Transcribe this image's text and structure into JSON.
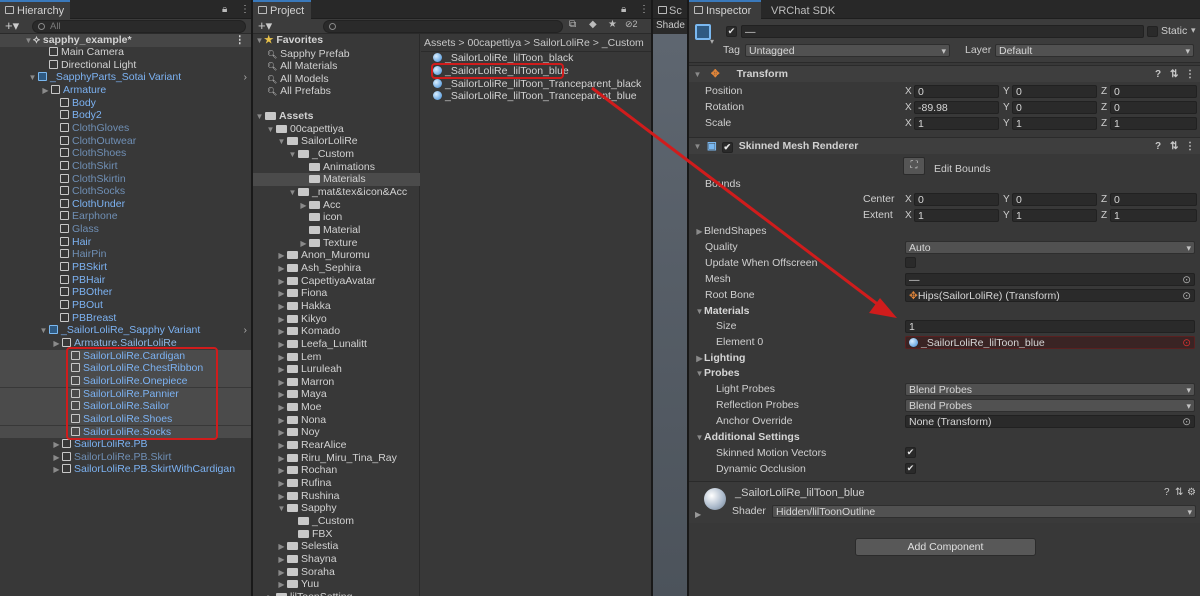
{
  "hierarchy": {
    "tab": "Hierarchy",
    "search_placeholder": "All",
    "scene": "sapphy_example*",
    "items": [
      {
        "label": "Main Camera",
        "cls": ""
      },
      {
        "label": "Directional Light",
        "cls": ""
      },
      {
        "label": "_SapphyParts_Sotai Variant",
        "cls": "blue"
      },
      {
        "label": "Armature",
        "cls": "blue"
      },
      {
        "label": "Body",
        "cls": "blue"
      },
      {
        "label": "Body2",
        "cls": "blue"
      },
      {
        "label": "ClothGloves",
        "cls": "dim"
      },
      {
        "label": "ClothOutwear",
        "cls": "dim"
      },
      {
        "label": "ClothShoes",
        "cls": "dim"
      },
      {
        "label": "ClothSkirt",
        "cls": "dim"
      },
      {
        "label": "ClothSkirtin",
        "cls": "dim"
      },
      {
        "label": "ClothSocks",
        "cls": "dim"
      },
      {
        "label": "ClothUnder",
        "cls": "blue"
      },
      {
        "label": "Earphone",
        "cls": "dim"
      },
      {
        "label": "Glass",
        "cls": "dim"
      },
      {
        "label": "Hair",
        "cls": "blue"
      },
      {
        "label": "HairPin",
        "cls": "dim"
      },
      {
        "label": "PBSkirt",
        "cls": "blue"
      },
      {
        "label": "PBHair",
        "cls": "blue"
      },
      {
        "label": "PBOther",
        "cls": "blue"
      },
      {
        "label": "PBOut",
        "cls": "blue"
      },
      {
        "label": "PBBreast",
        "cls": "blue"
      },
      {
        "label": "_SailorLoliRe_Sapphy Variant",
        "cls": "blue"
      },
      {
        "label": "Armature.SailorLoliRe",
        "cls": "blue"
      },
      {
        "label": "SailorLoliRe.Cardigan",
        "cls": "blue"
      },
      {
        "label": "SailorLoliRe.ChestRibbon",
        "cls": "blue"
      },
      {
        "label": "SailorLoliRe.Onepiece",
        "cls": "blue"
      },
      {
        "label": "SailorLoliRe.Pannier",
        "cls": "blue"
      },
      {
        "label": "SailorLoliRe.Sailor",
        "cls": "blue"
      },
      {
        "label": "SailorLoliRe.Shoes",
        "cls": "blue"
      },
      {
        "label": "SailorLoliRe.Socks",
        "cls": "blue"
      },
      {
        "label": "SailorLoliRe.PB",
        "cls": "blue"
      },
      {
        "label": "SailorLoliRe.PB.Skirt",
        "cls": "dim"
      },
      {
        "label": "SailorLoliRe.PB.SkirtWithCardigan",
        "cls": "blue"
      }
    ]
  },
  "project": {
    "tab": "Project",
    "favorites_label": "Favorites",
    "favorites": [
      "Sapphy Prefab",
      "All Materials",
      "All Models",
      "All Prefabs"
    ],
    "assets_label": "Assets",
    "tree": [
      "00capettiya",
      "SailorLoliRe",
      "_Custom",
      "Animations",
      "Materials",
      "_mat&tex&icon&Acc",
      "Acc",
      "icon",
      "Material",
      "Texture",
      "Anon_Muromu",
      "Ash_Sephira",
      "CapettiyaAvatar",
      "Fiona",
      "Hakka",
      "Kikyo",
      "Komado",
      "Leefa_Lunalitt",
      "Lem",
      "Luruleah",
      "Marron",
      "Maya",
      "Moe",
      "Nona",
      "Noy",
      "RearAlice",
      "Riru_Miru_Tina_Ray",
      "Rochan",
      "Rufina",
      "Rushina",
      "Sapphy",
      "_Custom",
      "FBX",
      "Selestia",
      "Shayna",
      "Soraha",
      "Yuu",
      "lilToonSetting"
    ],
    "breadcrumb": [
      "Assets",
      "00capettiya",
      "SailorLoliRe",
      "_Custom"
    ],
    "files": [
      "_SailorLoliRe_lilToon_black",
      "_SailorLoliRe_lilToon_blue",
      "_SailorLoliRe_lilToon_Tranceparent_black",
      "_SailorLoliRe_lilToon_Tranceparent_blue"
    ],
    "hidden_count": "2"
  },
  "scene_tab": {
    "tab": "Sc",
    "shade": "Shade"
  },
  "inspector": {
    "tab": "Inspector",
    "tab2": "VRChat SDK",
    "object_name": "—",
    "static_label": "Static",
    "tag_label": "Tag",
    "tag_value": "Untagged",
    "layer_label": "Layer",
    "layer_value": "Default",
    "transform": {
      "title": "Transform",
      "position_label": "Position",
      "position": [
        "0",
        "0",
        "0"
      ],
      "rotation_label": "Rotation",
      "rotation": [
        "-89.98",
        "0",
        "0"
      ],
      "scale_label": "Scale",
      "scale": [
        "1",
        "1",
        "1"
      ]
    },
    "smr": {
      "title": "Skinned Mesh Renderer",
      "edit_bounds": "Edit Bounds",
      "bounds_label": "Bounds",
      "center_label": "Center",
      "center": [
        "0",
        "0",
        "0"
      ],
      "extent_label": "Extent",
      "extent": [
        "1",
        "1",
        "1"
      ],
      "blendshapes": "BlendShapes",
      "quality_label": "Quality",
      "quality": "Auto",
      "update_offscreen_label": "Update When Offscreen",
      "mesh_label": "Mesh",
      "mesh": "—",
      "root_bone_label": "Root Bone",
      "root_bone": "Hips(SailorLoliRe) (Transform)",
      "materials_label": "Materials",
      "size_label": "Size",
      "size": "1",
      "element0_label": "Element 0",
      "element0": "_SailorLoliRe_lilToon_blue",
      "lighting": "Lighting",
      "probes": "Probes",
      "light_probes_label": "Light Probes",
      "light_probes": "Blend Probes",
      "reflection_probes_label": "Reflection Probes",
      "reflection_probes": "Blend Probes",
      "anchor_label": "Anchor Override",
      "anchor": "None (Transform)",
      "additional": "Additional Settings",
      "skinned_motion_label": "Skinned Motion Vectors",
      "dynamic_occlusion_label": "Dynamic Occlusion"
    },
    "material": {
      "name": "_SailorLoliRe_lilToon_blue",
      "shader_label": "Shader",
      "shader": "Hidden/lilToonOutline"
    },
    "add_component": "Add Component"
  },
  "colors": {
    "accent": "#3a79bb",
    "highlight_red": "#d01c1c",
    "blue_text": "#7cb2f2"
  }
}
